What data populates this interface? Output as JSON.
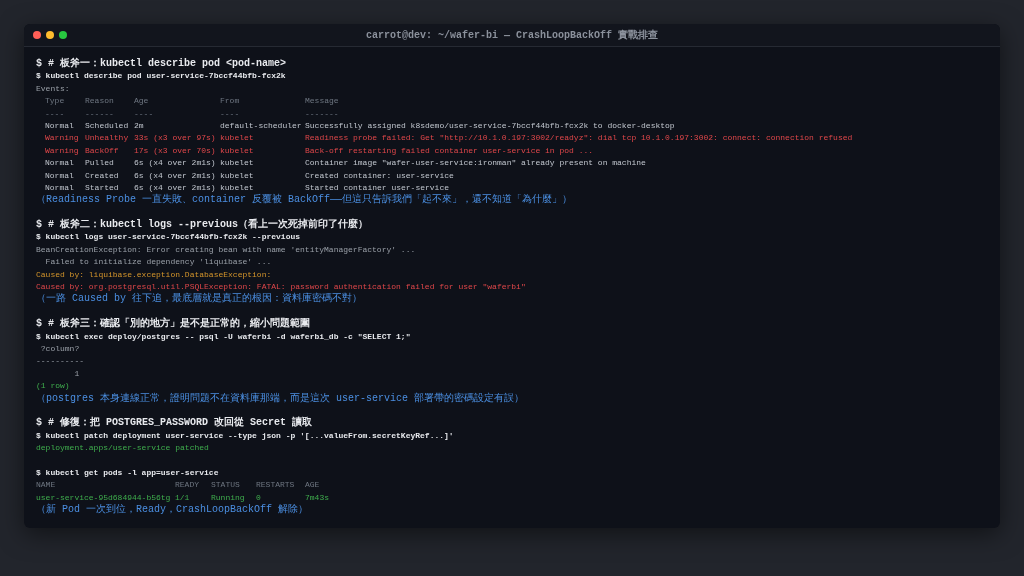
{
  "window": {
    "title": "carrot@dev: ~/wafer-bi — CrashLoopBackOff 實戰排查"
  },
  "lines": [
    {
      "kind": "comment",
      "text": "$ # 板斧一：kubectl describe pod <pod-name>"
    },
    {
      "kind": "cmd",
      "text": "$ kubectl describe pod user-service-7bccf44bfb-fcx2k"
    },
    {
      "kind": "out",
      "text": "Events:"
    },
    {
      "kind": "events_table",
      "rows": [
        {
          "kind": "header",
          "cells": [
            "Type",
            "Reason",
            "Age",
            "From",
            "Message"
          ]
        },
        {
          "kind": "header",
          "cells": [
            "----",
            "------",
            "----",
            "----",
            "-------"
          ]
        },
        {
          "kind": "normal",
          "cells": [
            "Normal",
            "Scheduled",
            "2m",
            "default-scheduler",
            "Successfully assigned k8sdemo/user-service-7bccf44bfb-fcx2k to docker-desktop"
          ]
        },
        {
          "kind": "warning",
          "cells": [
            "Warning",
            "Unhealthy",
            "33s (x3 over 97s)",
            "kubelet",
            "Readiness probe failed: Get \"http://10.1.0.197:3002/readyz\": dial tcp 10.1.0.197:3002: connect: connection refused"
          ]
        },
        {
          "kind": "warning",
          "cells": [
            "Warning",
            "BackOff",
            "17s (x3 over 70s)",
            "kubelet",
            "Back-off restarting failed container user-service in pod ..."
          ]
        },
        {
          "kind": "normal",
          "cells": [
            "Normal",
            "Pulled",
            "6s (x4 over 2m1s)",
            "kubelet",
            "Container image \"wafer-user-service:ironman\" already present on machine"
          ]
        },
        {
          "kind": "normal",
          "cells": [
            "Normal",
            "Created",
            "6s (x4 over 2m1s)",
            "kubelet",
            "Created container: user-service"
          ]
        },
        {
          "kind": "normal",
          "cells": [
            "Normal",
            "Started",
            "6s (x4 over 2m1s)",
            "kubelet",
            "Started container user-service"
          ]
        }
      ]
    },
    {
      "kind": "note",
      "text": "（Readiness Probe 一直失敗、container 反覆被 BackOff——但這只告訴我們「起不來」，還不知道「為什麼」）"
    },
    {
      "kind": "blank"
    },
    {
      "kind": "comment",
      "text": "$ # 板斧二：kubectl logs --previous（看上一次死掉前印了什麼）"
    },
    {
      "kind": "cmd",
      "text": "$ kubectl logs user-service-7bccf44bfb-fcx2k --previous"
    },
    {
      "kind": "out",
      "text": "BeanCreationException: Error creating bean with name 'entityManagerFactory' ..."
    },
    {
      "kind": "out",
      "text": "  Failed to initialize dependency 'liquibase' ..."
    },
    {
      "kind": "warn",
      "text": "Caused by: liquibase.exception.DatabaseException:"
    },
    {
      "kind": "err",
      "text": "Caused by: org.postgresql.util.PSQLException: FATAL: password authentication failed for user \"waferbi\""
    },
    {
      "kind": "note",
      "text": "（一路 Caused by 往下追，最底層就是真正的根因：資料庫密碼不對）"
    },
    {
      "kind": "blank"
    },
    {
      "kind": "comment",
      "text": "$ # 板斧三：確認「別的地方」是不是正常的，縮小問題範圍"
    },
    {
      "kind": "cmd",
      "text": "$ kubectl exec deploy/postgres -- psql -U waferbi -d waferbi_db -c \"SELECT 1;\""
    },
    {
      "kind": "out",
      "text": " ?column?"
    },
    {
      "kind": "out",
      "text": "----------"
    },
    {
      "kind": "out",
      "text": "        1"
    },
    {
      "kind": "ok",
      "text": "(1 row)"
    },
    {
      "kind": "note",
      "text": "（postgres 本身連線正常，證明問題不在資料庫那端，而是這次 user-service 部署帶的密碼設定有誤）"
    },
    {
      "kind": "blank"
    },
    {
      "kind": "comment",
      "text": "$ # 修復：把 POSTGRES_PASSWORD 改回從 Secret 讀取"
    },
    {
      "kind": "cmd",
      "text": "$ kubectl patch deployment user-service --type json -p '[...valueFrom.secretKeyRef...]'"
    },
    {
      "kind": "ok",
      "text": "deployment.apps/user-service patched"
    },
    {
      "kind": "blank"
    },
    {
      "kind": "cmd",
      "text": "$ kubectl get pods -l app=user-service"
    },
    {
      "kind": "pods_table",
      "rows": [
        {
          "kind": "header",
          "cells": [
            "NAME",
            "READY",
            "STATUS",
            "RESTARTS",
            "AGE"
          ]
        },
        {
          "kind": "running",
          "cells": [
            "user-service-95d684944-b56tg",
            "1/1",
            "Running",
            "0",
            "7m43s"
          ]
        }
      ]
    },
    {
      "kind": "note",
      "text": "（新 Pod 一次到位，Ready，CrashLoopBackOff 解除）"
    }
  ]
}
